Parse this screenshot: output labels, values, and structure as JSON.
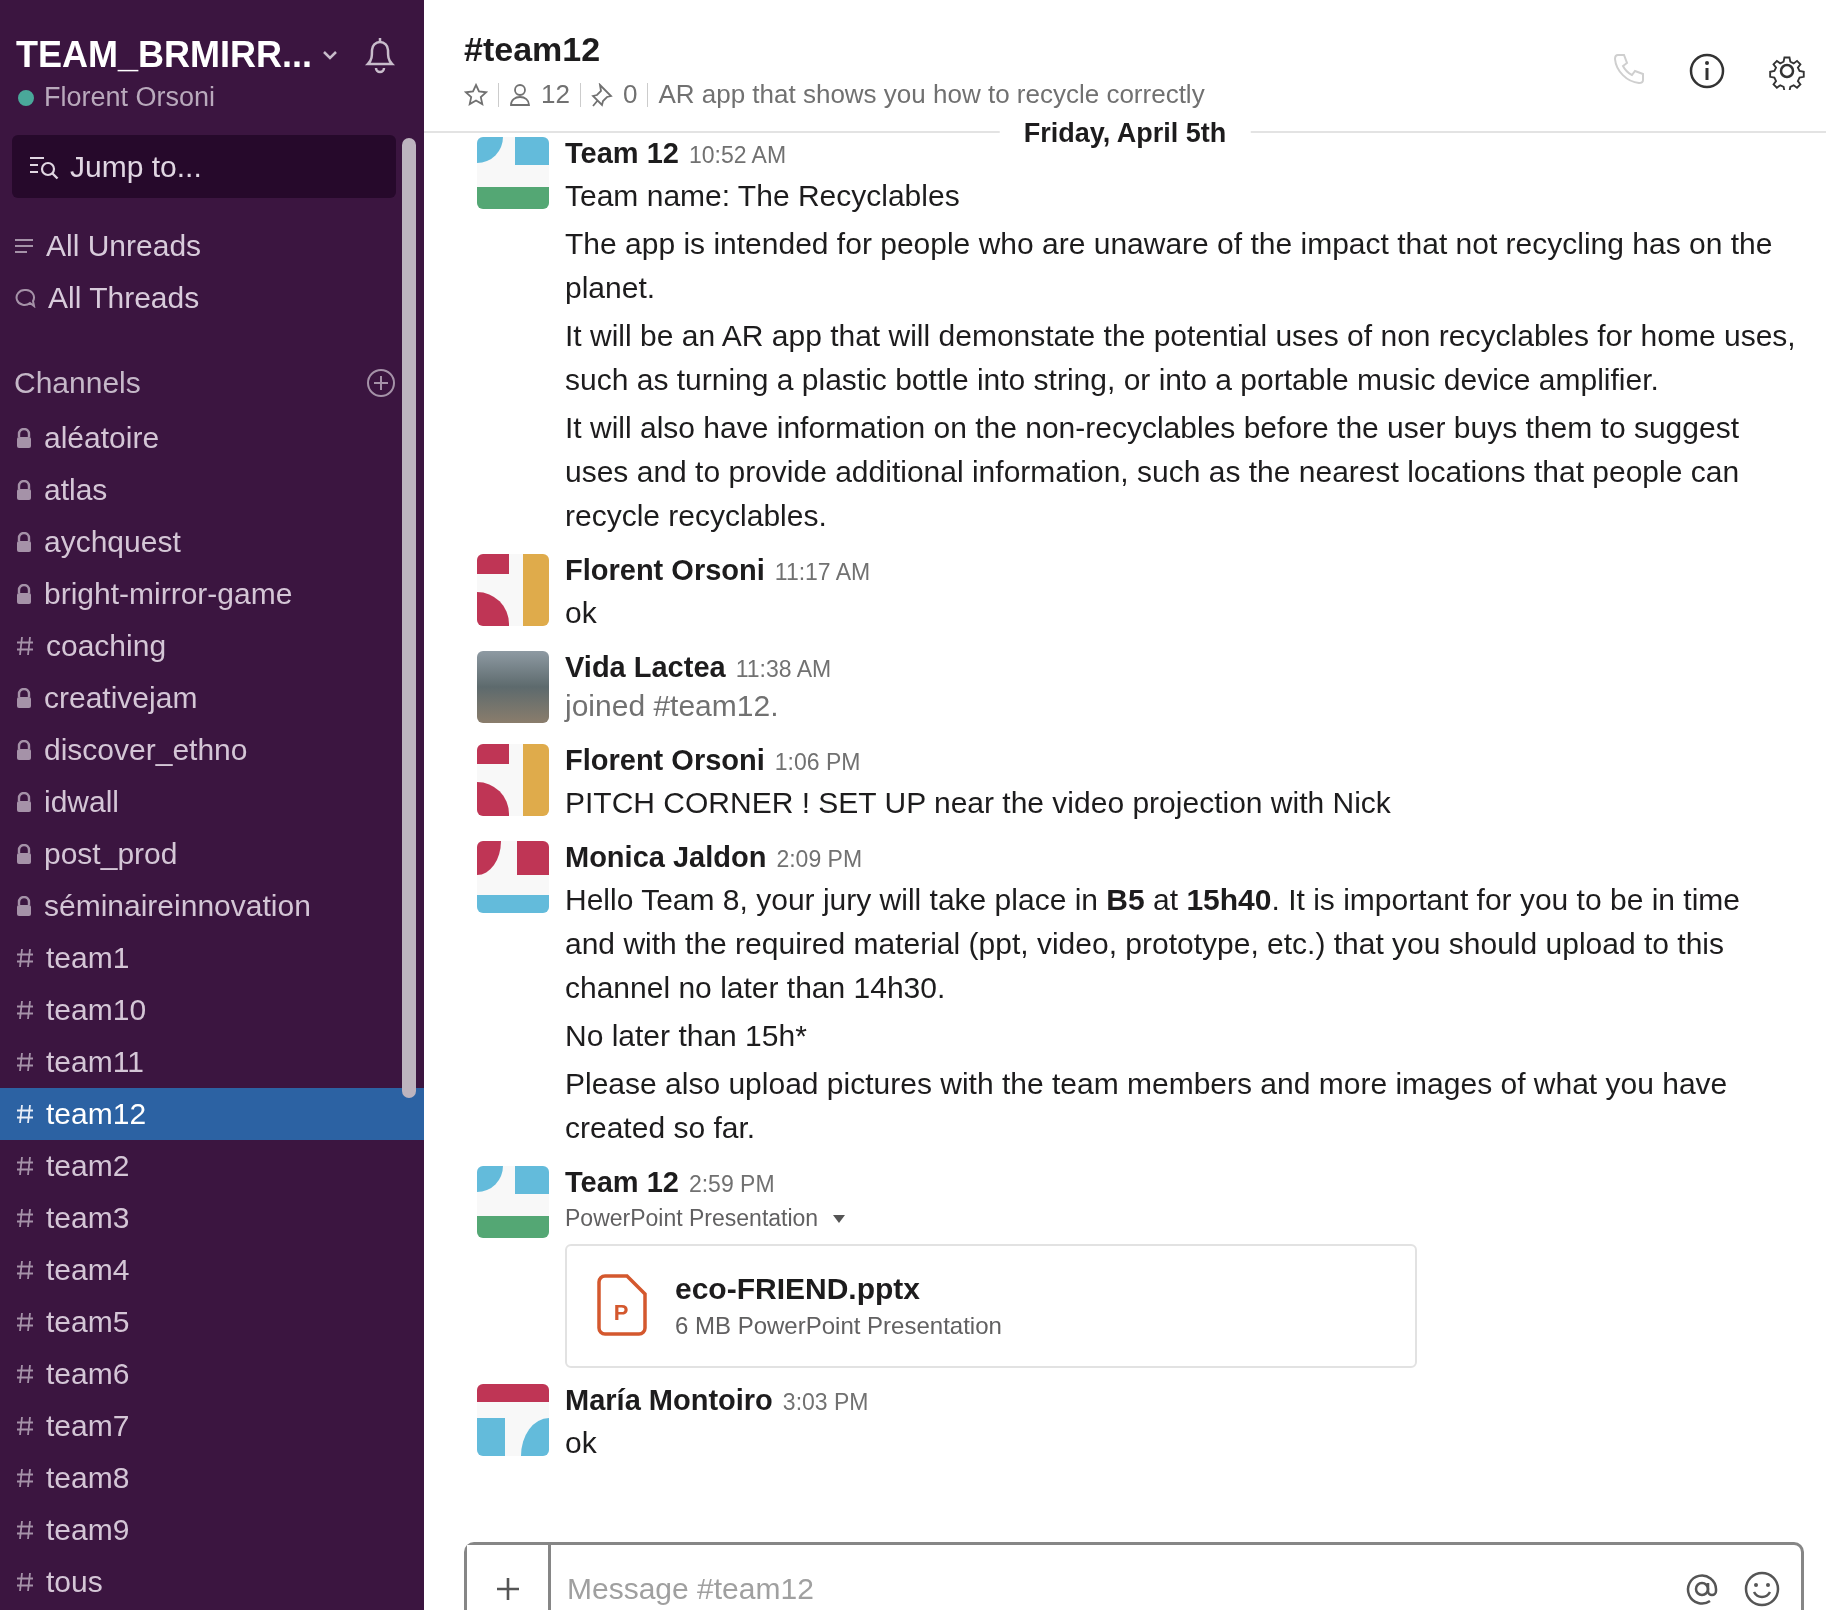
{
  "workspace": {
    "name": "TEAM_BRMIRR...",
    "user": "Florent Orsoni",
    "online": true
  },
  "jump_to": {
    "placeholder": "Jump to..."
  },
  "nav": [
    {
      "kind": "unreads",
      "label": "All Unreads"
    },
    {
      "kind": "threads",
      "label": "All Threads"
    }
  ],
  "channels_heading": "Channels",
  "channels": [
    {
      "name": "aléatoire",
      "kind": "private",
      "selected": false
    },
    {
      "name": "atlas",
      "kind": "private",
      "selected": false
    },
    {
      "name": "aychquest",
      "kind": "private",
      "selected": false
    },
    {
      "name": "bright-mirror-game",
      "kind": "private",
      "selected": false
    },
    {
      "name": "coaching",
      "kind": "public",
      "selected": false
    },
    {
      "name": "creativejam",
      "kind": "private",
      "selected": false
    },
    {
      "name": "discover_ethno",
      "kind": "private",
      "selected": false
    },
    {
      "name": "idwall",
      "kind": "private",
      "selected": false
    },
    {
      "name": "post_prod",
      "kind": "private",
      "selected": false
    },
    {
      "name": "séminaireinnovation",
      "kind": "private",
      "selected": false
    },
    {
      "name": "team1",
      "kind": "public",
      "selected": false
    },
    {
      "name": "team10",
      "kind": "public",
      "selected": false
    },
    {
      "name": "team11",
      "kind": "public",
      "selected": false
    },
    {
      "name": "team12",
      "kind": "public",
      "selected": true
    },
    {
      "name": "team2",
      "kind": "public",
      "selected": false
    },
    {
      "name": "team3",
      "kind": "public",
      "selected": false
    },
    {
      "name": "team4",
      "kind": "public",
      "selected": false
    },
    {
      "name": "team5",
      "kind": "public",
      "selected": false
    },
    {
      "name": "team6",
      "kind": "public",
      "selected": false
    },
    {
      "name": "team7",
      "kind": "public",
      "selected": false
    },
    {
      "name": "team8",
      "kind": "public",
      "selected": false
    },
    {
      "name": "team9",
      "kind": "public",
      "selected": false
    },
    {
      "name": "tous",
      "kind": "public",
      "selected": false
    }
  ],
  "channel_header": {
    "title": "#team12",
    "members": "12",
    "pins": "0",
    "topic": "AR app that shows you how to recycle correctly"
  },
  "date_divider": "Friday, April 5th",
  "messages": [
    {
      "author": "Team 12",
      "time": "10:52 AM",
      "avatar": {
        "kind": "blue-green"
      },
      "kind": "text",
      "paragraphs": [
        "Team name: The Recyclables",
        "The app is intended for people who are unaware of the impact that not recycling has on the planet.",
        "It will be an AR app that will demonstate the potential uses of non recyclables for home uses, such as turning a plastic bottle into string, or into a portable music device amplifier.",
        "It will also have information on the non-recyclables before the user buys them to suggest uses and to provide additional information, such as the nearest locations that people can recycle recyclables."
      ]
    },
    {
      "author": "Florent Orsoni",
      "time": "11:17 AM",
      "avatar": {
        "kind": "red-gold"
      },
      "kind": "text",
      "paragraphs": [
        "ok"
      ]
    },
    {
      "author": "Vida Lactea",
      "time": "11:38 AM",
      "avatar": {
        "kind": "photo"
      },
      "kind": "join",
      "paragraphs": [
        "joined #team12."
      ]
    },
    {
      "author": "Florent Orsoni",
      "time": "1:06 PM",
      "avatar": {
        "kind": "red-gold"
      },
      "kind": "text",
      "paragraphs": [
        "PITCH CORNER ! SET UP near the video projection with Nick"
      ]
    },
    {
      "author": "Monica Jaldon",
      "time": "2:09 PM",
      "avatar": {
        "kind": "red-blue"
      },
      "kind": "text",
      "paragraphs": [
        "Hello Team 8, your jury will take place in  **B5** at **15h40**. It is important for you to be in time and with the required material (ppt, video, prototype, etc.) that you should upload to this channel no later than 14h30.",
        "No later than 15h*",
        "Please also upload pictures with the team members and more images of what you have created so far."
      ]
    },
    {
      "author": "Team 12",
      "time": "2:59 PM",
      "avatar": {
        "kind": "blue-green"
      },
      "kind": "file",
      "file_label": "PowerPoint Presentation",
      "file": {
        "name": "eco-FRIEND.pptx",
        "meta": "6 MB PowerPoint Presentation",
        "letter": "P"
      }
    },
    {
      "author": "María Montoiro",
      "time": "3:03 PM",
      "avatar": {
        "kind": "red-top"
      },
      "kind": "text",
      "paragraphs": [
        "ok"
      ]
    }
  ],
  "composer": {
    "placeholder": "Message #team12"
  }
}
